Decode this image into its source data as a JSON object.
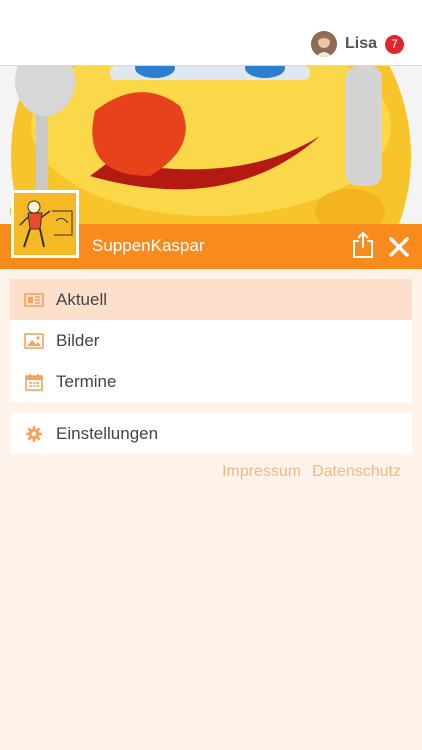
{
  "header": {
    "username": "Lisa",
    "notification_count": "7"
  },
  "club": {
    "name": "SuppenKaspar"
  },
  "menu": {
    "items": [
      {
        "label": "Aktuell",
        "icon": "news-icon",
        "active": true
      },
      {
        "label": "Bilder",
        "icon": "image-icon",
        "active": false
      },
      {
        "label": "Termine",
        "icon": "calendar-icon",
        "active": false
      }
    ],
    "settings": {
      "label": "Einstellungen",
      "icon": "gear-icon"
    }
  },
  "footer": {
    "impressum": "Impressum",
    "datenschutz": "Datenschutz"
  },
  "colors": {
    "accent": "#f88b1b",
    "badge": "#e0262b",
    "active_bg": "#fde0cc",
    "link": "#f4b784",
    "icon": "#f6a35c"
  }
}
